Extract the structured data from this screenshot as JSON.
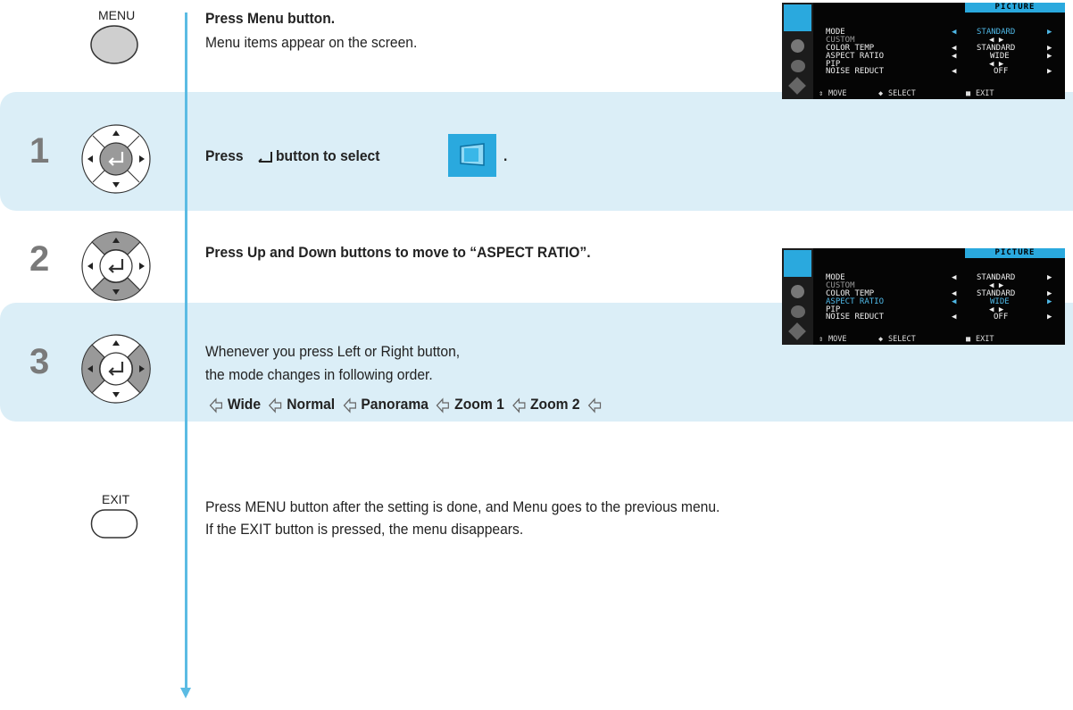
{
  "buttons": {
    "menu_label": "MENU",
    "exit_label": "EXIT"
  },
  "steps": {
    "s1": "1",
    "s2": "2",
    "s3": "3"
  },
  "text": {
    "intro_title": "Press Menu button.",
    "intro_body": "Menu items appear on the screen.",
    "step1_pre": "Press",
    "step1_post": "button to select",
    "step1_end": ".",
    "step2": "Press Up and Down buttons to move to  “ASPECT RATIO”.",
    "step3_line1": "Whenever you press Left or Right button,",
    "step3_line2": "the mode changes in following order.",
    "sequence": [
      "Wide",
      "Normal",
      "Panorama",
      "Zoom 1",
      "Zoom 2"
    ],
    "exit_line1": "Press MENU button after the setting is done, and Menu goes to the previous menu.",
    "exit_line2": "If the EXIT button is pressed, the menu disappears."
  },
  "osd": {
    "title": "PICTURE",
    "rows": [
      {
        "label": "MODE",
        "value": "STANDARD"
      },
      {
        "label": "CUSTOM",
        "value": ""
      },
      {
        "label": "COLOR TEMP",
        "value": "STANDARD"
      },
      {
        "label": "ASPECT RATIO",
        "value": "WIDE"
      },
      {
        "label": "PIP",
        "value": ""
      },
      {
        "label": "NOISE REDUCT",
        "value": "OFF"
      }
    ],
    "footer": {
      "move": "MOVE",
      "select": "SELECT",
      "exit": "EXIT"
    }
  },
  "colors": {
    "band": "#dbeef7",
    "flowline": "#5bbbe3",
    "osd_accent": "#2aa9de"
  }
}
